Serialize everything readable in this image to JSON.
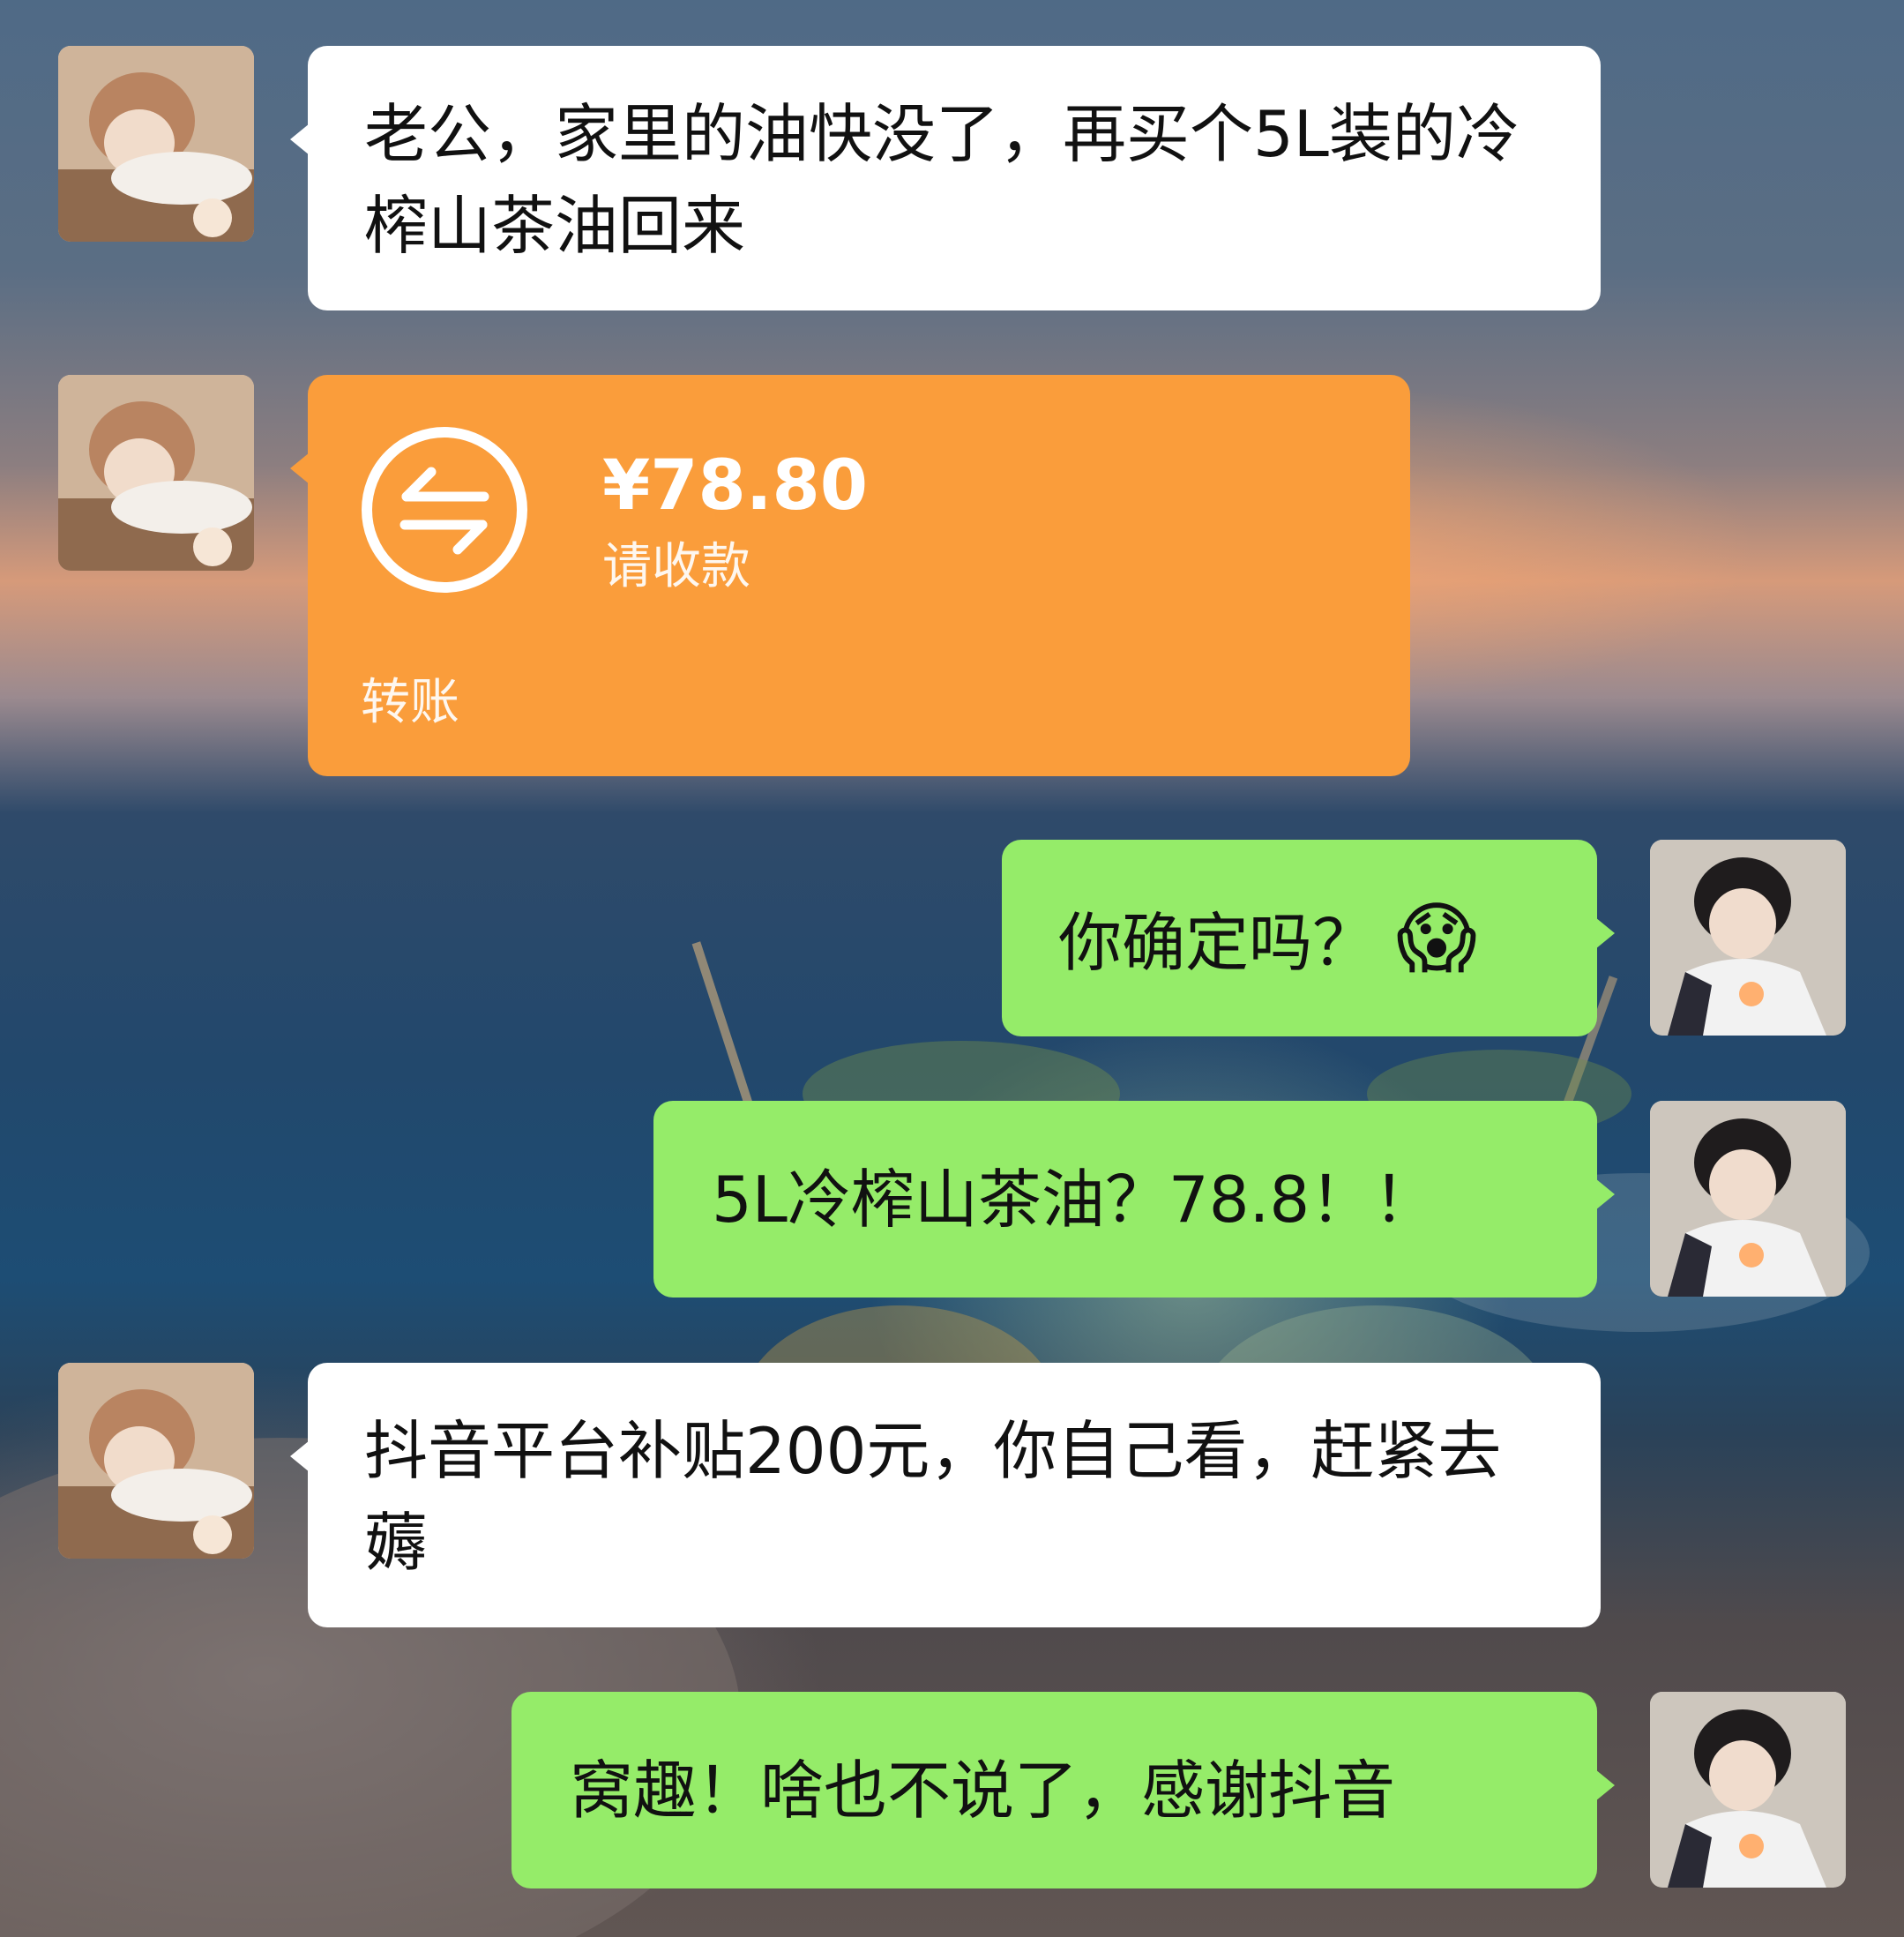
{
  "messages": [
    {
      "sender": "her",
      "type": "text",
      "text": "老公，家里的油快没了，再买个5L装的冷榨山茶油回来"
    },
    {
      "sender": "her",
      "type": "transfer",
      "amount": "¥78.80",
      "status": "请收款",
      "footer": "转账"
    },
    {
      "sender": "him",
      "type": "text",
      "text": "你确定吗？",
      "emoji": "😱"
    },
    {
      "sender": "him",
      "type": "text",
      "text": "5L冷榨山茶油？78.8！！"
    },
    {
      "sender": "her",
      "type": "text",
      "text": "抖音平台补贴200元，你自己看，赶紧去薅"
    },
    {
      "sender": "him",
      "type": "text",
      "text": "窝趣！啥也不说了，感谢抖音"
    }
  ],
  "colors": {
    "incoming_bubble": "#ffffff",
    "outgoing_bubble": "#95ec69",
    "transfer_card": "#fa9d3b"
  },
  "icons": {
    "transfer": "transfer-arrows-icon"
  }
}
